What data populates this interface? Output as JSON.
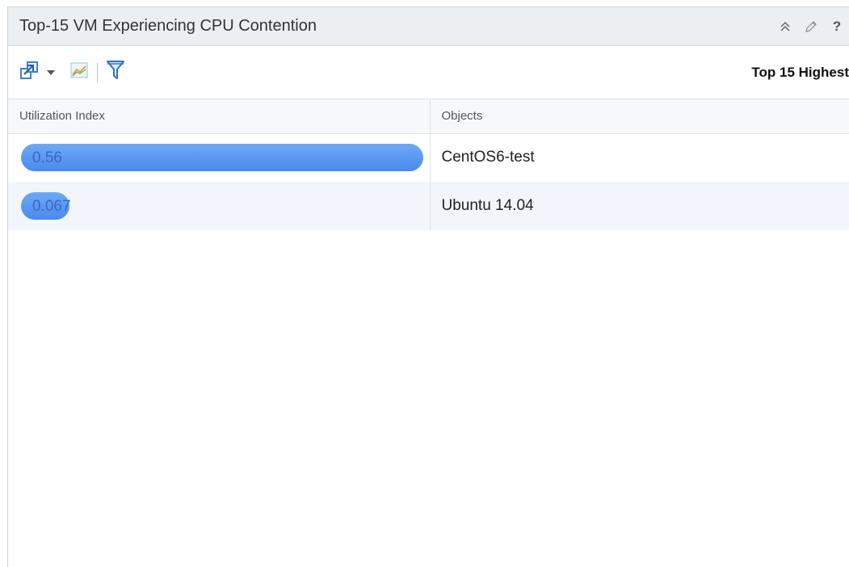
{
  "widget": {
    "title": "Top-15 VM Experiencing CPU Contention",
    "help_label": "?"
  },
  "toolbar": {
    "right_label": "Top 15 Highest"
  },
  "table": {
    "columns": [
      "Utilization Index",
      "Objects"
    ],
    "rows": [
      {
        "index": "0.56",
        "index_fraction": 1.0,
        "object": "CentOS6-test"
      },
      {
        "index": "0.067",
        "index_fraction": 0.12,
        "object": "Ubuntu 14.04"
      }
    ]
  },
  "colors": {
    "bar": "#5b97f2",
    "bar_label": "#3a66c4",
    "header_bg": "#eceff1",
    "alt_row_bg": "#f2f6fc"
  },
  "icons": {
    "toolbar": [
      "export-icon",
      "dropdown-caret-icon",
      "chart-icon",
      "filter-icon"
    ],
    "title": [
      "collapse-icon",
      "edit-icon",
      "help-icon"
    ]
  }
}
